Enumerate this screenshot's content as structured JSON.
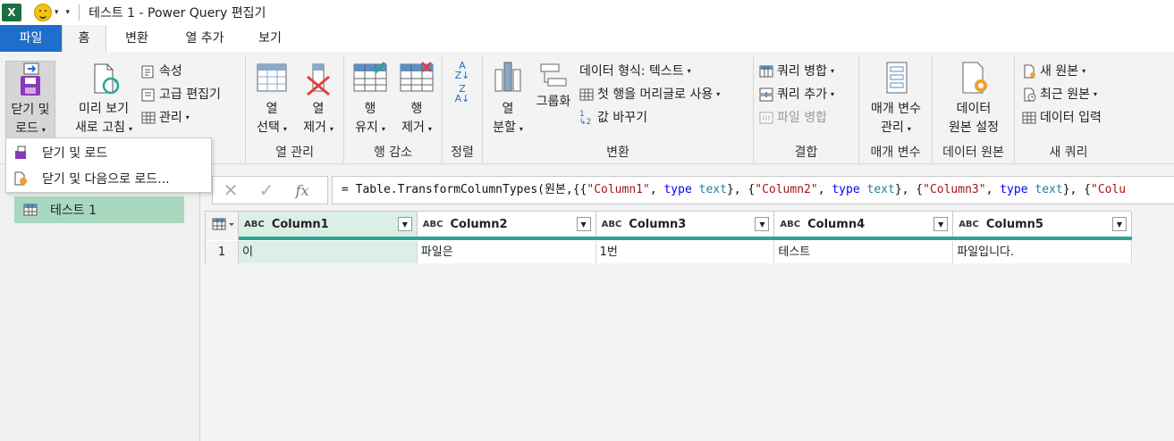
{
  "titlebar": {
    "excel_icon": "excel-icon",
    "title": "테스트 1 - Power Query 편집기"
  },
  "tabs": {
    "file": "파일",
    "home": "홈",
    "transform": "변환",
    "add_column": "열 추가",
    "view": "보기"
  },
  "ribbon": {
    "close": {
      "line1": "닫기 및",
      "line2": "로드"
    },
    "query": {
      "preview_line1": "미리 보기",
      "preview_line2": "새로 고침",
      "properties": "속성",
      "advanced_editor": "고급 편집기",
      "manage": "관리"
    },
    "manage_columns": {
      "choose_line1": "열",
      "choose_line2": "선택",
      "remove_line1": "열",
      "remove_line2": "제거",
      "label": "열 관리"
    },
    "reduce_rows": {
      "keep_line1": "행",
      "keep_line2": "유지",
      "remove_line1": "행",
      "remove_line2": "제거",
      "label": "행 감소"
    },
    "sort": {
      "label": "정렬"
    },
    "transform": {
      "split_line1": "열",
      "split_line2": "분할",
      "group_by": "그룹화",
      "data_type": "데이터 형식: 텍스트",
      "first_row_header": "첫 행을 머리글로 사용",
      "replace_values": "값 바꾸기",
      "label": "변환"
    },
    "combine": {
      "merge_queries": "쿼리 병합",
      "append_queries": "쿼리 추가",
      "combine_files": "파일 병합",
      "label": "결합"
    },
    "parameters": {
      "manage_line1": "매개 변수",
      "manage_line2": "관리",
      "label": "매개 변수"
    },
    "data_sources": {
      "settings_line1": "데이터",
      "settings_line2": "원본 설정",
      "label": "데이터 원본"
    },
    "new_query": {
      "new_source": "새 원본",
      "recent_sources": "최근 원본",
      "enter_data": "데이터 입력",
      "label": "새 쿼리"
    }
  },
  "dropdown": {
    "item1": "닫기 및 로드",
    "item2": "닫기 및 다음으로 로드..."
  },
  "queries_pane": {
    "items": [
      "테스트 1"
    ]
  },
  "formula_bar": {
    "cancel_icon": "close-icon",
    "commit_icon": "check-icon",
    "fx_label": "fx",
    "formula": "= Table.TransformColumnTypes(원본,{{\"Column1\", type text}, {\"Column2\", type text}, {\"Column3\", type text}, {\"Colu"
  },
  "grid": {
    "type_label": "ABC",
    "columns": [
      "Column1",
      "Column2",
      "Column3",
      "Column4",
      "Column5"
    ],
    "rows": [
      {
        "num": "1",
        "cells": [
          "이",
          "파일은",
          "1번",
          "테스트",
          "파일입니다."
        ]
      }
    ]
  },
  "colors": {
    "file_tab": "#1e6fcd",
    "selected_query": "#a9d8c0",
    "quality_bar": "#2aa692",
    "selected_column": "#dcefe6"
  }
}
